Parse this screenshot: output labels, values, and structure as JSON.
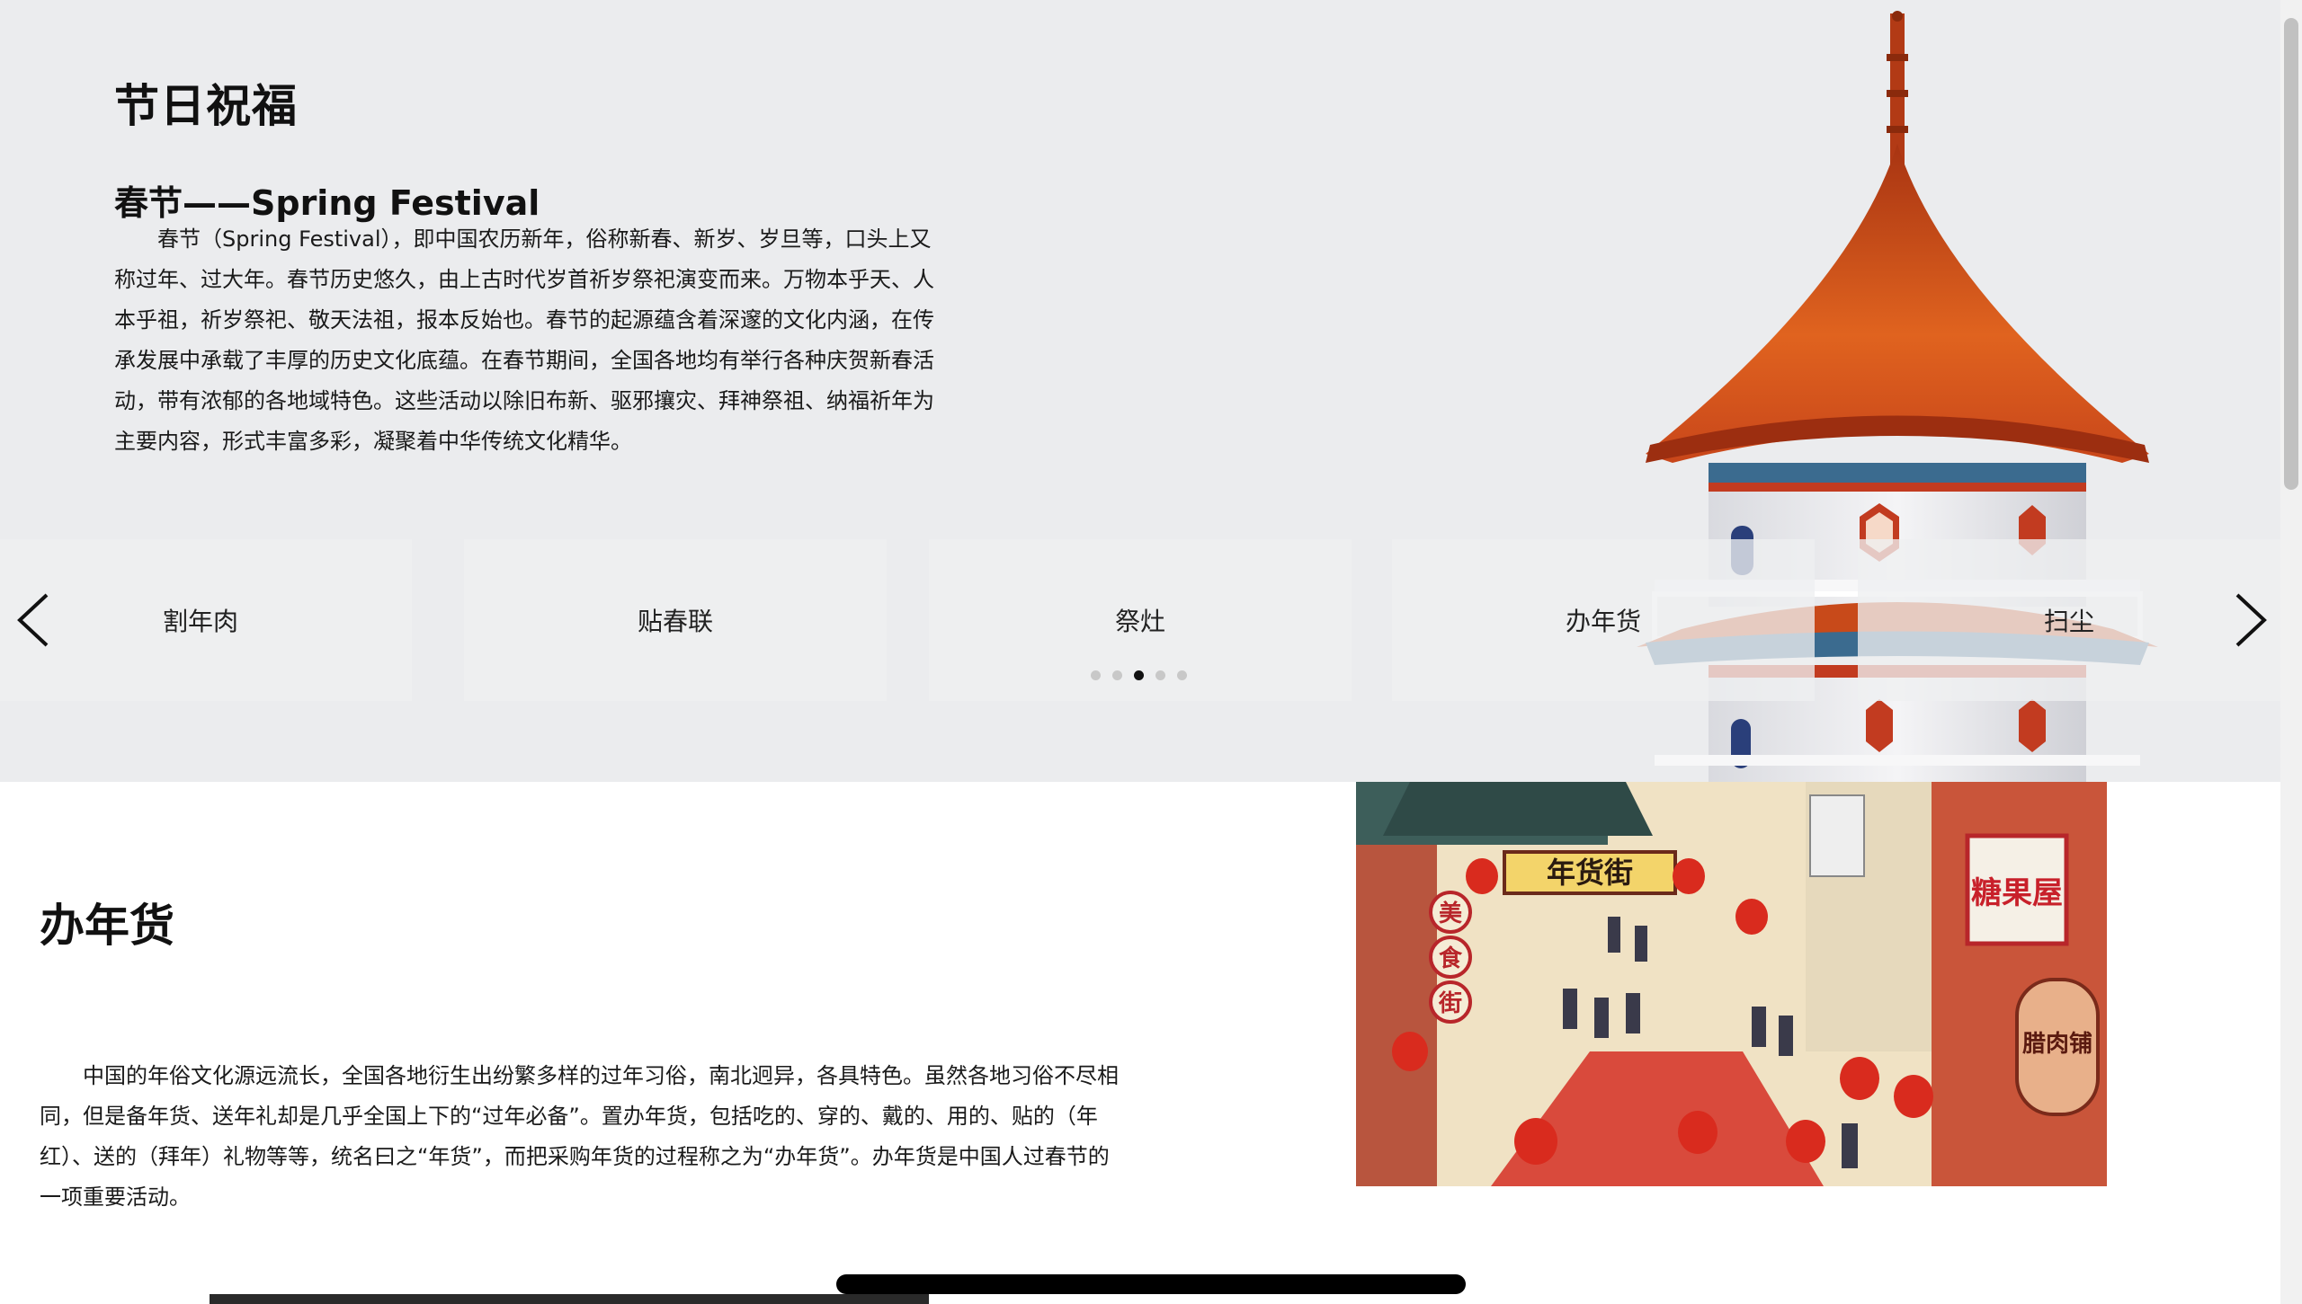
{
  "hero": {
    "title": "节日祝福",
    "festival_title": "春节——Spring Festival",
    "festival_desc": "春节（Spring Festival），即中国农历新年，俗称新春、新岁、岁旦等，口头上又称过年、过大年。春节历史悠久，由上古时代岁首祈岁祭祀演变而来。万物本乎天、人本乎祖，祈岁祭祀、敬天法祖，报本反始也。春节的起源蕴含着深邃的文化内涵，在传承发展中承载了丰厚的历史文化底蕴。在春节期间，全国各地均有举行各种庆贺新春活动，带有浓郁的各地域特色。这些活动以除旧布新、驱邪攘灾、拜神祭祖、纳福祈年为主要内容，形式丰富多彩，凝聚着中华传统文化精华。"
  },
  "carousel": {
    "prev_icon": "chevron-left-icon",
    "next_icon": "chevron-right-icon",
    "items": [
      {
        "label": "割年肉"
      },
      {
        "label": "贴春联"
      },
      {
        "label": "祭灶"
      },
      {
        "label": "办年货"
      },
      {
        "label": "扫尘"
      }
    ],
    "dot_count": 5,
    "active_index": 2
  },
  "section": {
    "title": "办年货",
    "desc": "中国的年俗文化源远流长，全国各地衍生出纷繁多样的过年习俗，南北迥异，各具特色。虽然各地习俗不尽相同，但是备年货、送年礼却是几乎全国上下的“过年必备”。置办年货，包括吃的、穿的、戴的、用的、贴的（年红）、送的（拜年）礼物等等，统名曰之“年货”，而把采购年货的过程称之为“办年货”。办年货是中国人过春节的一项重要活动。",
    "image": {
      "sign_main": "年货街",
      "sign_candy": "糖果屋",
      "sign_food_1": "美",
      "sign_food_2": "食",
      "sign_food_3": "街",
      "sign_meat": "腊肉铺"
    }
  },
  "colors": {
    "hero_bg": "#ebecee",
    "roof_orange": "#d2541c",
    "lantern_red": "#d92b1e"
  }
}
